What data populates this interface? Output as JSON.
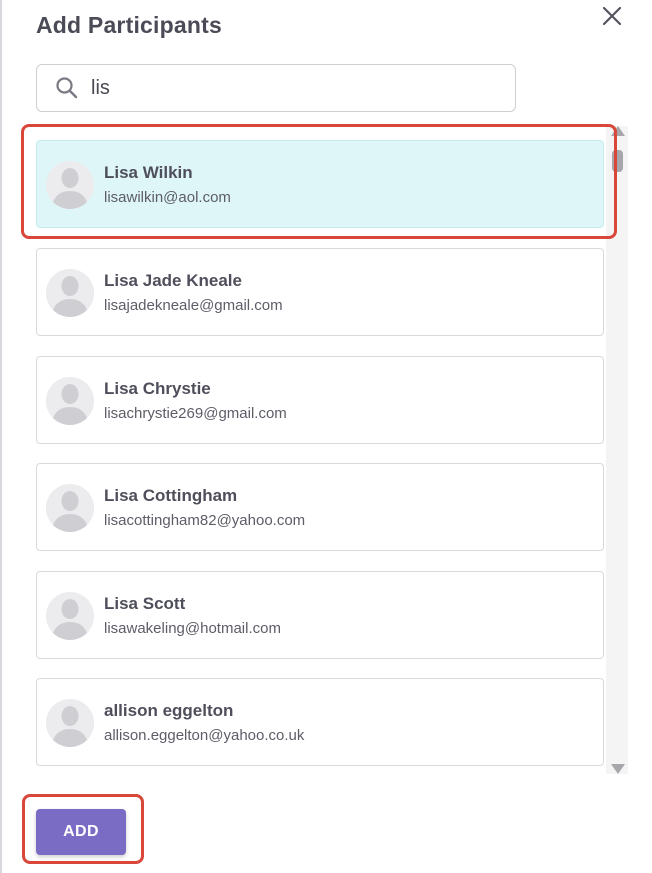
{
  "dialog": {
    "title": "Add Participants",
    "close_icon": "close-icon"
  },
  "search": {
    "icon": "search-icon",
    "value": "lis"
  },
  "participants": [
    {
      "name": "Lisa Wilkin",
      "email": "lisawilkin@aol.com",
      "selected": true
    },
    {
      "name": "Lisa Jade Kneale",
      "email": "lisajadekneale@gmail.com",
      "selected": false
    },
    {
      "name": "Lisa Chrystie",
      "email": "lisachrystie269@gmail.com",
      "selected": false
    },
    {
      "name": "Lisa Cottingham",
      "email": "lisacottingham82@yahoo.com",
      "selected": false
    },
    {
      "name": "Lisa Scott",
      "email": "lisawakeling@hotmail.com",
      "selected": false
    },
    {
      "name": "allison eggelton",
      "email": "allison.eggelton@yahoo.co.uk",
      "selected": false
    }
  ],
  "actions": {
    "add_label": "ADD"
  },
  "colors": {
    "accent": "#7a6bc4",
    "selected_background": "#def6f8",
    "highlight": "#d9473a"
  }
}
